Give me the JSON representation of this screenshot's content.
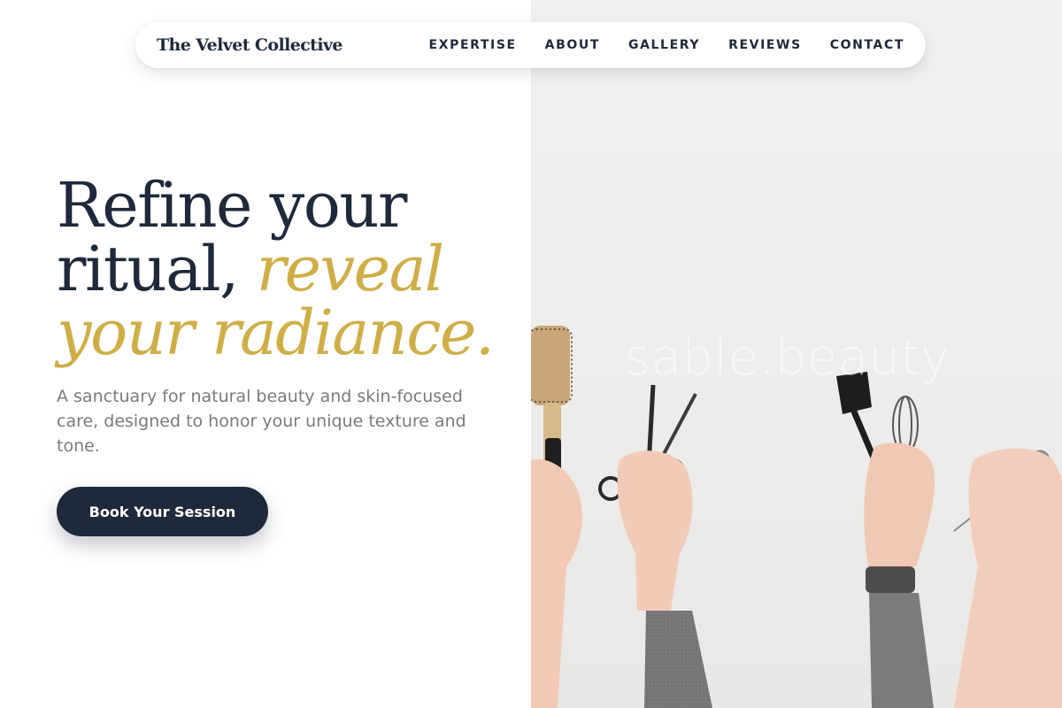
{
  "nav": {
    "brand": "The Velvet Collective",
    "links": [
      {
        "label": "EXPERTISE"
      },
      {
        "label": "ABOUT"
      },
      {
        "label": "GALLERY"
      },
      {
        "label": "REVIEWS"
      },
      {
        "label": "CONTACT"
      }
    ]
  },
  "hero": {
    "headline_part1": "Refine your ritual,",
    "headline_accent": "reveal your radiance.",
    "subtext": "A sanctuary for natural beauty and skin-focused care, designed to honor your unique texture and tone.",
    "cta_label": "Book Your Session"
  },
  "photo": {
    "watermark": "sable.beauty",
    "depicts": [
      "round-brush",
      "scissors",
      "tint-brush",
      "whisk",
      "shears"
    ]
  },
  "colors": {
    "navy": "#1e293b",
    "gold": "#cfae47",
    "muted_text": "#7a7a7a",
    "photo_bg": "#ededeb"
  }
}
